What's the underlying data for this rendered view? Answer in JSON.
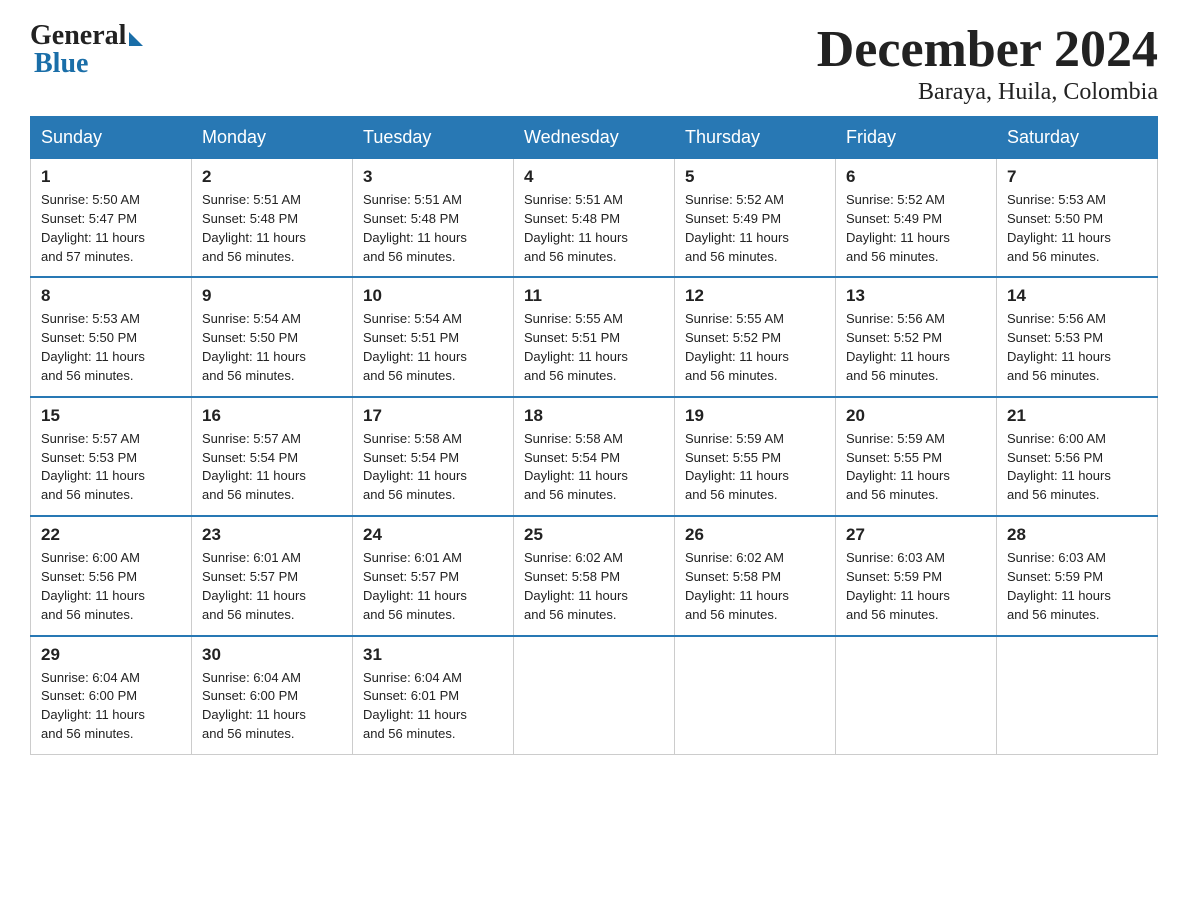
{
  "logo": {
    "general": "General",
    "blue": "Blue"
  },
  "title": "December 2024",
  "subtitle": "Baraya, Huila, Colombia",
  "days_of_week": [
    "Sunday",
    "Monday",
    "Tuesday",
    "Wednesday",
    "Thursday",
    "Friday",
    "Saturday"
  ],
  "weeks": [
    [
      {
        "day": "1",
        "sunrise": "5:50 AM",
        "sunset": "5:47 PM",
        "daylight": "11 hours and 57 minutes."
      },
      {
        "day": "2",
        "sunrise": "5:51 AM",
        "sunset": "5:48 PM",
        "daylight": "11 hours and 56 minutes."
      },
      {
        "day": "3",
        "sunrise": "5:51 AM",
        "sunset": "5:48 PM",
        "daylight": "11 hours and 56 minutes."
      },
      {
        "day": "4",
        "sunrise": "5:51 AM",
        "sunset": "5:48 PM",
        "daylight": "11 hours and 56 minutes."
      },
      {
        "day": "5",
        "sunrise": "5:52 AM",
        "sunset": "5:49 PM",
        "daylight": "11 hours and 56 minutes."
      },
      {
        "day": "6",
        "sunrise": "5:52 AM",
        "sunset": "5:49 PM",
        "daylight": "11 hours and 56 minutes."
      },
      {
        "day": "7",
        "sunrise": "5:53 AM",
        "sunset": "5:50 PM",
        "daylight": "11 hours and 56 minutes."
      }
    ],
    [
      {
        "day": "8",
        "sunrise": "5:53 AM",
        "sunset": "5:50 PM",
        "daylight": "11 hours and 56 minutes."
      },
      {
        "day": "9",
        "sunrise": "5:54 AM",
        "sunset": "5:50 PM",
        "daylight": "11 hours and 56 minutes."
      },
      {
        "day": "10",
        "sunrise": "5:54 AM",
        "sunset": "5:51 PM",
        "daylight": "11 hours and 56 minutes."
      },
      {
        "day": "11",
        "sunrise": "5:55 AM",
        "sunset": "5:51 PM",
        "daylight": "11 hours and 56 minutes."
      },
      {
        "day": "12",
        "sunrise": "5:55 AM",
        "sunset": "5:52 PM",
        "daylight": "11 hours and 56 minutes."
      },
      {
        "day": "13",
        "sunrise": "5:56 AM",
        "sunset": "5:52 PM",
        "daylight": "11 hours and 56 minutes."
      },
      {
        "day": "14",
        "sunrise": "5:56 AM",
        "sunset": "5:53 PM",
        "daylight": "11 hours and 56 minutes."
      }
    ],
    [
      {
        "day": "15",
        "sunrise": "5:57 AM",
        "sunset": "5:53 PM",
        "daylight": "11 hours and 56 minutes."
      },
      {
        "day": "16",
        "sunrise": "5:57 AM",
        "sunset": "5:54 PM",
        "daylight": "11 hours and 56 minutes."
      },
      {
        "day": "17",
        "sunrise": "5:58 AM",
        "sunset": "5:54 PM",
        "daylight": "11 hours and 56 minutes."
      },
      {
        "day": "18",
        "sunrise": "5:58 AM",
        "sunset": "5:54 PM",
        "daylight": "11 hours and 56 minutes."
      },
      {
        "day": "19",
        "sunrise": "5:59 AM",
        "sunset": "5:55 PM",
        "daylight": "11 hours and 56 minutes."
      },
      {
        "day": "20",
        "sunrise": "5:59 AM",
        "sunset": "5:55 PM",
        "daylight": "11 hours and 56 minutes."
      },
      {
        "day": "21",
        "sunrise": "6:00 AM",
        "sunset": "5:56 PM",
        "daylight": "11 hours and 56 minutes."
      }
    ],
    [
      {
        "day": "22",
        "sunrise": "6:00 AM",
        "sunset": "5:56 PM",
        "daylight": "11 hours and 56 minutes."
      },
      {
        "day": "23",
        "sunrise": "6:01 AM",
        "sunset": "5:57 PM",
        "daylight": "11 hours and 56 minutes."
      },
      {
        "day": "24",
        "sunrise": "6:01 AM",
        "sunset": "5:57 PM",
        "daylight": "11 hours and 56 minutes."
      },
      {
        "day": "25",
        "sunrise": "6:02 AM",
        "sunset": "5:58 PM",
        "daylight": "11 hours and 56 minutes."
      },
      {
        "day": "26",
        "sunrise": "6:02 AM",
        "sunset": "5:58 PM",
        "daylight": "11 hours and 56 minutes."
      },
      {
        "day": "27",
        "sunrise": "6:03 AM",
        "sunset": "5:59 PM",
        "daylight": "11 hours and 56 minutes."
      },
      {
        "day": "28",
        "sunrise": "6:03 AM",
        "sunset": "5:59 PM",
        "daylight": "11 hours and 56 minutes."
      }
    ],
    [
      {
        "day": "29",
        "sunrise": "6:04 AM",
        "sunset": "6:00 PM",
        "daylight": "11 hours and 56 minutes."
      },
      {
        "day": "30",
        "sunrise": "6:04 AM",
        "sunset": "6:00 PM",
        "daylight": "11 hours and 56 minutes."
      },
      {
        "day": "31",
        "sunrise": "6:04 AM",
        "sunset": "6:01 PM",
        "daylight": "11 hours and 56 minutes."
      },
      null,
      null,
      null,
      null
    ]
  ],
  "labels": {
    "sunrise": "Sunrise:",
    "sunset": "Sunset:",
    "daylight": "Daylight:"
  }
}
